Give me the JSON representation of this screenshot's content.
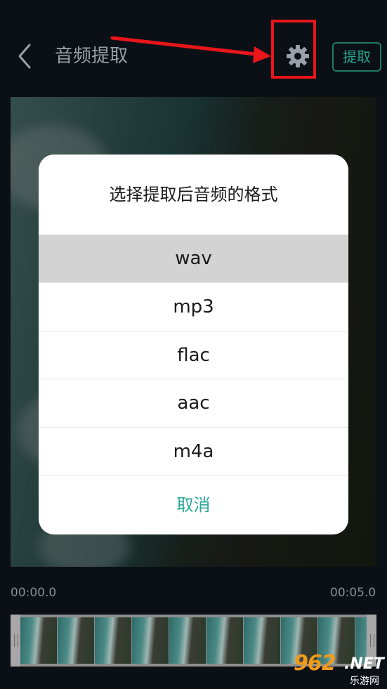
{
  "header": {
    "title": "音频提取",
    "extract_label": "提取"
  },
  "dialog": {
    "title": "选择提取后音频的格式",
    "options": [
      "wav",
      "mp3",
      "flac",
      "aac",
      "m4a"
    ],
    "selected": "wav",
    "cancel_label": "取消"
  },
  "timeline": {
    "start_time": "00:00.0",
    "end_time": "00:05.0"
  },
  "watermark": {
    "main": "962",
    "suffix": ".NET",
    "sub": "乐游网"
  },
  "colors": {
    "accent": "#26a58a",
    "highlight": "#e8161b",
    "background": "#0b0f16"
  }
}
